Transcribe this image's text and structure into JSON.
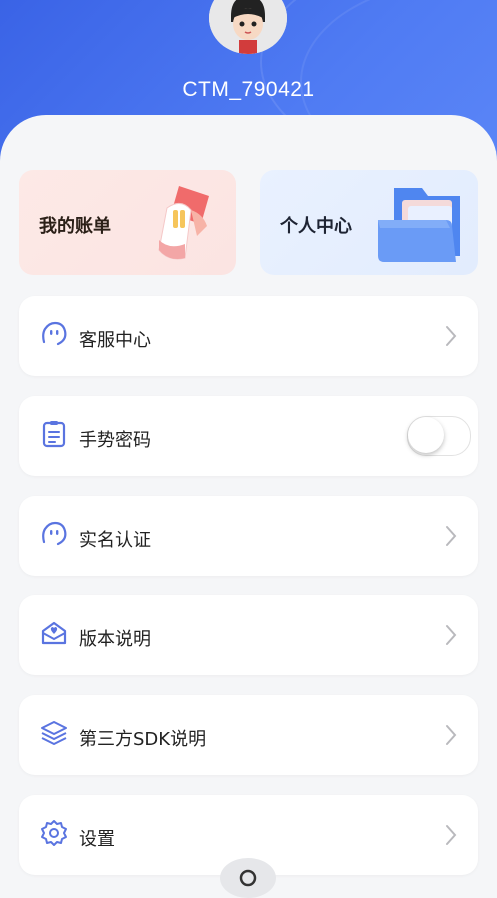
{
  "profile": {
    "username": "CTM_790421"
  },
  "cards": [
    {
      "label": "我的账单",
      "icon": "receipt-icon"
    },
    {
      "label": "个人中心",
      "icon": "folder-icon"
    }
  ],
  "menu": [
    {
      "label": "客服中心",
      "icon": "smile-face-icon",
      "control": "chevron"
    },
    {
      "label": "手势密码",
      "icon": "clipboard-icon",
      "control": "toggle",
      "toggle_on": false
    },
    {
      "label": "实名认证",
      "icon": "smile-face-icon",
      "control": "chevron"
    },
    {
      "label": "版本说明",
      "icon": "mail-heart-icon",
      "control": "chevron"
    },
    {
      "label": "第三方SDK说明",
      "icon": "layers-icon",
      "control": "chevron"
    },
    {
      "label": "设置",
      "icon": "gear-icon",
      "control": "chevron"
    }
  ],
  "colors": {
    "header": "#4670ee",
    "accent_icon": "#5a74e0"
  }
}
